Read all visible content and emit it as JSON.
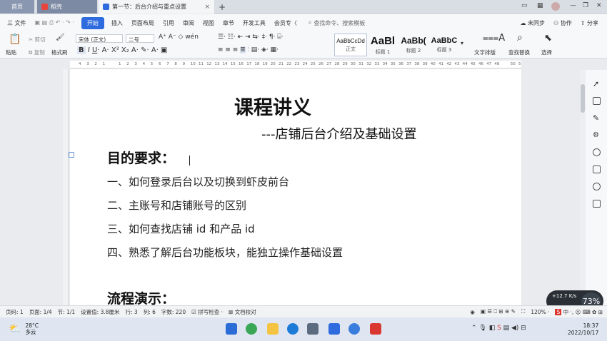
{
  "tabs": {
    "home": "首页",
    "daoke": "稻壳",
    "doc": "第一节：后台介绍与重点设置",
    "add": "+"
  },
  "menu": {
    "file": "三 文件",
    "start": "开始",
    "items": [
      "插入",
      "页面布局",
      "引用",
      "审阅",
      "视图",
      "章节",
      "开发工具",
      "会员专〈"
    ],
    "search": "查找命令、搜索模板",
    "unsync": "未同步",
    "collab": "协作",
    "share": "分享"
  },
  "toolbar": {
    "paste": "粘贴",
    "cut": "剪切",
    "copy": "复制",
    "format_painter": "格式刷",
    "font_name": "宋体 (正文)",
    "font_size": "二号",
    "styles": [
      {
        "preview": "AaBbCcDd",
        "label": "正文"
      },
      {
        "preview": "AaBl",
        "label": "标题 1"
      },
      {
        "preview": "AaBb(",
        "label": "标题 2"
      },
      {
        "preview": "AaBbC",
        "label": "标题 3"
      }
    ],
    "text_layout": "文字排版",
    "find_replace": "查找替换",
    "select": "选择"
  },
  "ruler": [
    "4",
    "3",
    "2",
    "1",
    "",
    "1",
    "2",
    "3",
    "4",
    "5",
    "6",
    "7",
    "8",
    "9",
    "10",
    "11",
    "12",
    "13",
    "14",
    "15",
    "16",
    "17",
    "18",
    "19",
    "20",
    "21",
    "22",
    "23",
    "24",
    "25",
    "26",
    "27",
    "28",
    "29",
    "30",
    "31",
    "32",
    "33",
    "34",
    "35",
    "36",
    "37",
    "38",
    "39",
    "40",
    "41",
    "42",
    "43",
    "44",
    "45",
    "46",
    "47",
    "48",
    "",
    "50",
    "51"
  ],
  "document": {
    "title": "课程讲义",
    "subtitle": "---店铺后台介绍及基础设置",
    "heading": "目的要求：",
    "items": [
      "一、如何登录后台以及切换到虾皮前台",
      "二、主账号和店铺账号的区别",
      "三、如何查找店铺 id 和产品 id",
      "四、熟悉了解后台功能板块，能独立操作基础设置"
    ],
    "heading2": "流程演示："
  },
  "statusbar": {
    "page_code": "页码: 1",
    "page": "页面: 1/4",
    "section": "节: 1/1",
    "setting": "设置值: 3.8厘米",
    "row": "行: 3",
    "col": "列: 6",
    "word_count": "字数: 220",
    "spell_check": "拼写检查 ·",
    "doc_check": "文档校对",
    "zoom": "120% ·"
  },
  "netwidget": {
    "speed": "+12.7",
    "unit": "K/s",
    "percent": "73%"
  },
  "taskbar": {
    "temp": "28°C",
    "weather": "多云",
    "time": "18:37",
    "date": "2022/10/17"
  },
  "colors": {
    "accent": "#2e6bdf",
    "wps_red": "#d9372f"
  }
}
